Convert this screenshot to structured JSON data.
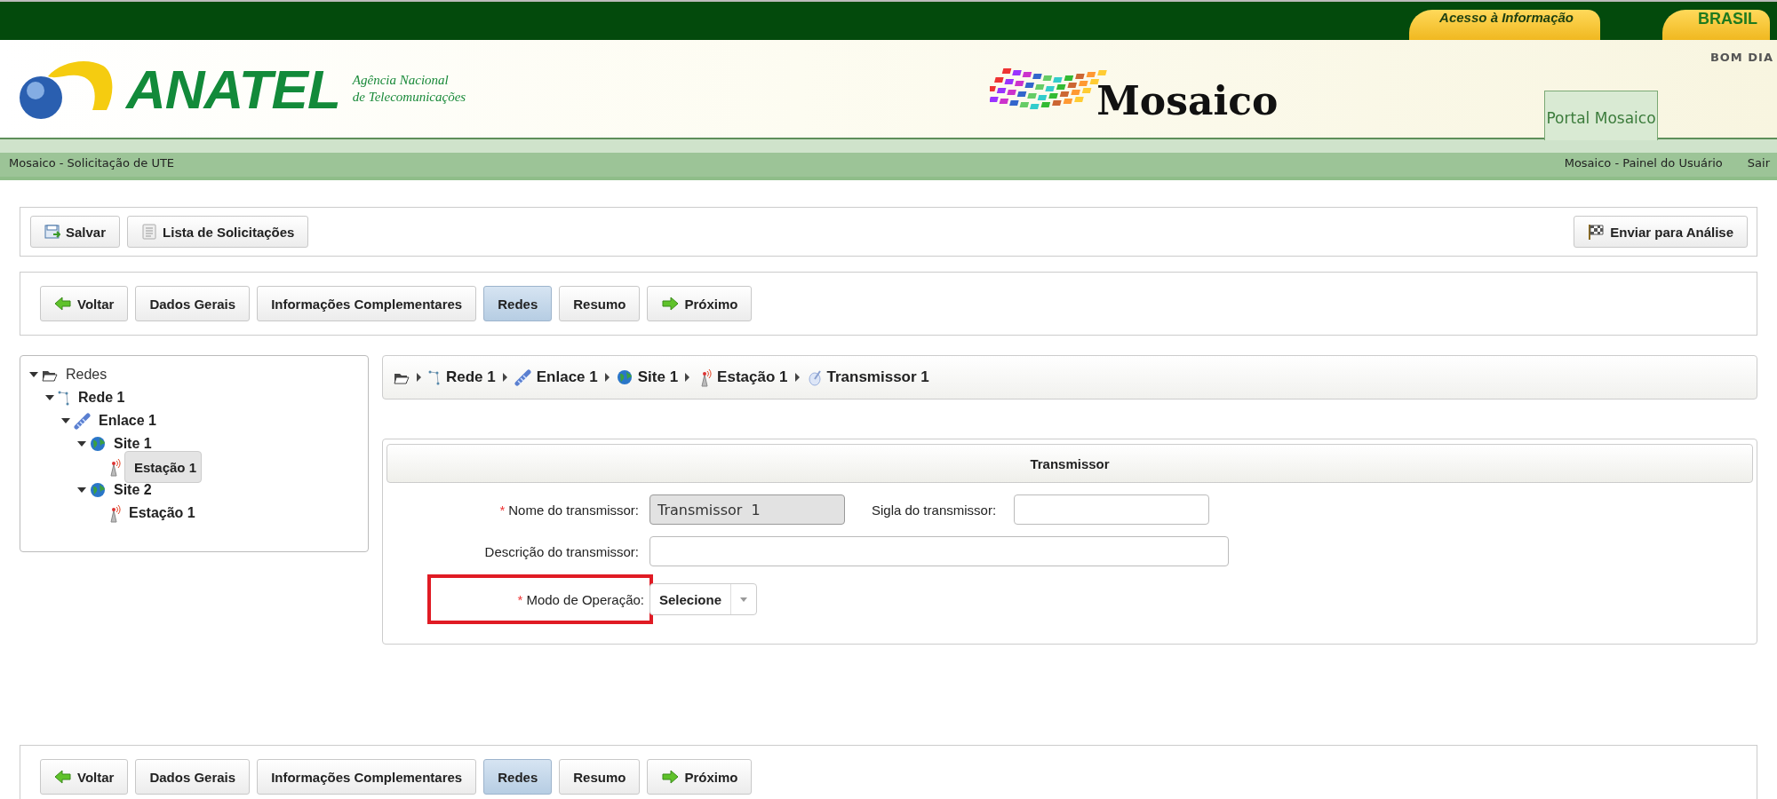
{
  "gov_bar": {
    "access_link": "Acesso à Informação",
    "brasil": "BRASIL"
  },
  "header": {
    "agency_logo": {
      "name": "ANATEL",
      "subtitle_1": "Agência Nacional",
      "subtitle_2": "de Telecomunicações"
    },
    "app_logo": "Mosaico",
    "greeting": "BOM DIA",
    "portal_tab": "Portal Mosaico"
  },
  "menu_bar": {
    "title": "Mosaico - Solicitação de UTE",
    "links": [
      "Mosaico - Painel do Usuário",
      "Sair"
    ]
  },
  "actions": {
    "left": [
      {
        "label": "Salvar",
        "kind": "save"
      },
      {
        "label": "Lista de Solicitações",
        "kind": "list"
      }
    ],
    "right": [
      {
        "label": "Enviar para Análise",
        "kind": "flag"
      }
    ]
  },
  "steps_top": [
    {
      "label": "Voltar",
      "kind": "back",
      "selected": false
    },
    {
      "label": "Dados Gerais",
      "kind": "step",
      "selected": false
    },
    {
      "label": "Informações Complementares",
      "kind": "step",
      "selected": false
    },
    {
      "label": "Redes",
      "kind": "step",
      "selected": true
    },
    {
      "label": "Resumo",
      "kind": "step",
      "selected": false
    },
    {
      "label": "Próximo",
      "kind": "next",
      "selected": false
    }
  ],
  "tree": [
    {
      "label": "Redes",
      "kind": "folder",
      "expanded": true,
      "selected": false,
      "children": [
        {
          "label": "Rede 1",
          "kind": "network",
          "expanded": true,
          "selected": false,
          "children": [
            {
              "label": "Enlace 1",
              "kind": "link",
              "expanded": true,
              "selected": false,
              "children": [
                {
                  "label": "Site 1",
                  "kind": "site",
                  "expanded": true,
                  "selected": false,
                  "children": [
                    {
                      "label": "Estação 1",
                      "kind": "station",
                      "selected": true
                    }
                  ]
                },
                {
                  "label": "Site 2",
                  "kind": "site",
                  "expanded": true,
                  "selected": false,
                  "children": [
                    {
                      "label": "Estação 1",
                      "kind": "station",
                      "selected": false
                    }
                  ]
                }
              ]
            }
          ]
        }
      ]
    }
  ],
  "path": [
    {
      "kind": "folder"
    },
    {
      "label": "Rede 1",
      "kind": "network"
    },
    {
      "label": "Enlace 1",
      "kind": "link"
    },
    {
      "label": "Site 1",
      "kind": "site"
    },
    {
      "label": "Estação 1",
      "kind": "station"
    },
    {
      "label": "Transmissor 1",
      "kind": "transmitter"
    }
  ],
  "transmitter": {
    "title": "Transmissor",
    "rows": [
      [
        {
          "label": "Nome do transmissor:",
          "required_mark": "*",
          "kind": "text",
          "value": "Transmissor  1",
          "disabled": true,
          "highlighted": false
        },
        {
          "label": "Sigla do transmissor:",
          "kind": "text",
          "disabled": false,
          "highlighted": false
        }
      ],
      [
        {
          "label": "Descrição do transmissor:",
          "kind": "text",
          "disabled": false,
          "highlighted": false
        }
      ],
      [
        {
          "label": "Modo de Operação:",
          "required_mark": "*",
          "kind": "select",
          "value": "Selecione",
          "highlighted": true
        }
      ]
    ]
  },
  "steps_bottom": [
    {
      "label": "Voltar",
      "kind": "back",
      "selected": false
    },
    {
      "label": "Dados Gerais",
      "kind": "step",
      "selected": false
    },
    {
      "label": "Informações Complementares",
      "kind": "step",
      "selected": false
    },
    {
      "label": "Redes",
      "kind": "step",
      "selected": true
    },
    {
      "label": "Resumo",
      "kind": "step",
      "selected": false
    },
    {
      "label": "Próximo",
      "kind": "next",
      "selected": false
    }
  ]
}
